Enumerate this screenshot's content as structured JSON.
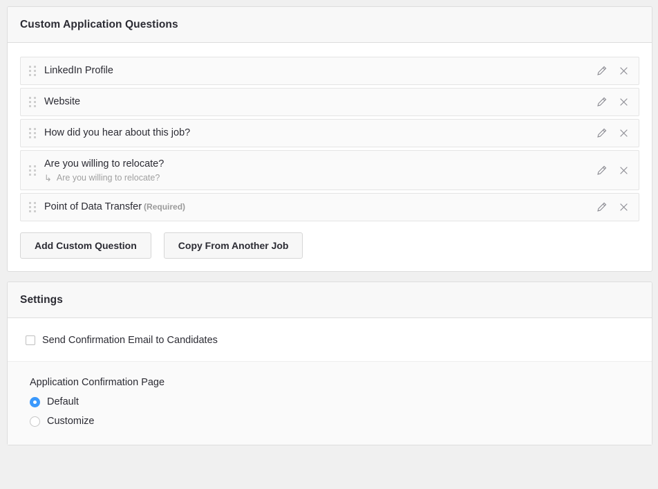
{
  "colors": {
    "accent": "#3b99fc",
    "page_bg": "#f0f0f0",
    "card_bg": "#ffffff",
    "card_header_bg": "#f8f8f8",
    "row_bg": "#fafafa",
    "text": "#2b2b33",
    "muted": "#9a9a9a"
  },
  "questions_card": {
    "title": "Custom Application Questions",
    "rows": [
      {
        "label": "LinkedIn Profile",
        "required_label": "",
        "sub": "",
        "drag_icon": "drag-handle-icon",
        "edit_icon": "pencil-icon",
        "delete_icon": "close-icon"
      },
      {
        "label": "Website",
        "required_label": "",
        "sub": "",
        "drag_icon": "drag-handle-icon",
        "edit_icon": "pencil-icon",
        "delete_icon": "close-icon"
      },
      {
        "label": "How did you hear about this job?",
        "required_label": "",
        "sub": "",
        "drag_icon": "drag-handle-icon",
        "edit_icon": "pencil-icon",
        "delete_icon": "close-icon"
      },
      {
        "label": "Are you willing to relocate?",
        "required_label": "",
        "sub": "Are you willing to relocate?",
        "sub_arrow": "↳",
        "drag_icon": "drag-handle-icon",
        "edit_icon": "pencil-icon",
        "delete_icon": "close-icon"
      },
      {
        "label": "Point of Data Transfer",
        "required_label": "(Required)",
        "sub": "",
        "drag_icon": "drag-handle-icon",
        "edit_icon": "pencil-icon",
        "delete_icon": "close-icon"
      }
    ],
    "buttons": {
      "add_custom_question": "Add Custom Question",
      "copy_from_another_job": "Copy From Another Job"
    }
  },
  "settings_card": {
    "title": "Settings",
    "send_confirmation_email": {
      "label": "Send Confirmation Email to Candidates",
      "checked": false
    },
    "confirmation_page": {
      "title": "Application Confirmation Page",
      "options": [
        {
          "label": "Default",
          "selected": true
        },
        {
          "label": "Customize",
          "selected": false
        }
      ]
    }
  }
}
